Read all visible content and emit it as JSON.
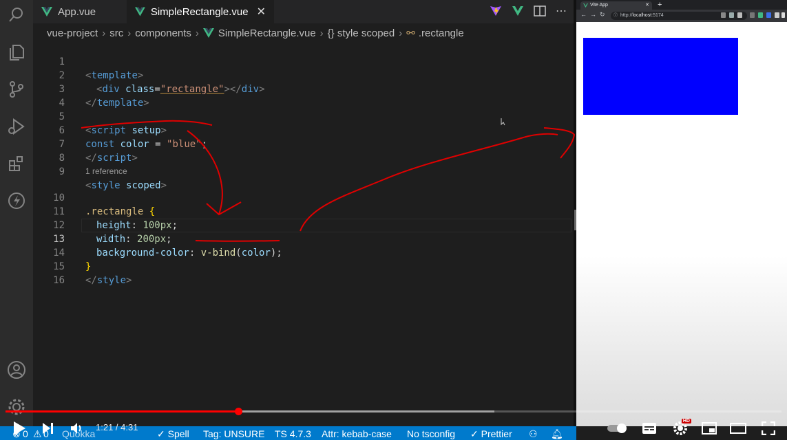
{
  "tabs": [
    {
      "label": "App.vue"
    },
    {
      "label": "SimpleRectangle.vue"
    }
  ],
  "breadcrumb": [
    "vue-project",
    "src",
    "components",
    "SimpleRectangle.vue",
    "{} style scoped",
    ".rectangle"
  ],
  "code": {
    "line_numbers": [
      "1",
      "2",
      "3",
      "4",
      "5",
      "6",
      "7",
      "8",
      "9",
      "10",
      "11",
      "12",
      "13",
      "14",
      "15",
      "16"
    ],
    "codelens": "1 reference",
    "l1": [
      "<",
      "template",
      ">"
    ],
    "l2": [
      "<",
      "div",
      " ",
      "class",
      "=",
      "\"rectangle\"",
      ">",
      "</",
      "div",
      ">"
    ],
    "l3": [
      "</",
      "template",
      ">"
    ],
    "l5": [
      "<",
      "script",
      " ",
      "setup",
      ">"
    ],
    "l6": [
      "const",
      " ",
      "color",
      " = ",
      "\"blue\"",
      ";"
    ],
    "l7": [
      "</",
      "script",
      ">"
    ],
    "l9": [
      "<",
      "style",
      " ",
      "scoped",
      ">"
    ],
    "l10": [
      ".rectangle",
      " ",
      "{"
    ],
    "l11": [
      "height",
      ": ",
      "100px",
      ";"
    ],
    "l12": [
      "width",
      ": ",
      "200px",
      ";"
    ],
    "l13": [
      "background-color",
      ": ",
      "v-bind",
      "(",
      "color",
      ")",
      ";"
    ],
    "l14": [
      "}"
    ],
    "l15": [
      "</",
      "style",
      ">"
    ]
  },
  "browser": {
    "tab_title": "Vite App",
    "url_scheme": "http://",
    "url_host": "localhost",
    "url_port": ":5174",
    "rectangle_color": "#0000ff"
  },
  "player": {
    "time": "1:21 / 4:31",
    "played_fraction": 0.3,
    "buffered_fraction": 0.63,
    "hd_badge": "HD"
  },
  "statusbar": {
    "errors": "0",
    "warnings": "0",
    "quokka": "Quokka",
    "spell": "✓ Spell",
    "tag": "Tag: UNSURE",
    "ts": "TS 4.7.3",
    "attr": "Attr: kebab-case",
    "tsconfig": "No tsconfig",
    "prettier": "✓ Prettier"
  },
  "colors": {
    "accent_vue": "#41b883",
    "status_blue": "#007acc",
    "annotation_red": "#e00000",
    "progress_red": "#ff0000"
  },
  "icons": [
    "search-icon",
    "explorer-icon",
    "source-control-icon",
    "run-debug-icon",
    "extensions-icon",
    "lightning-icon",
    "account-icon",
    "gear-icon",
    "split-editor-icon",
    "more-icon",
    "play-icon",
    "next-icon",
    "volume-icon",
    "autoplay-toggle-icon",
    "subtitles-icon",
    "settings-icon",
    "miniplayer-icon",
    "theater-icon",
    "fullscreen-icon"
  ]
}
